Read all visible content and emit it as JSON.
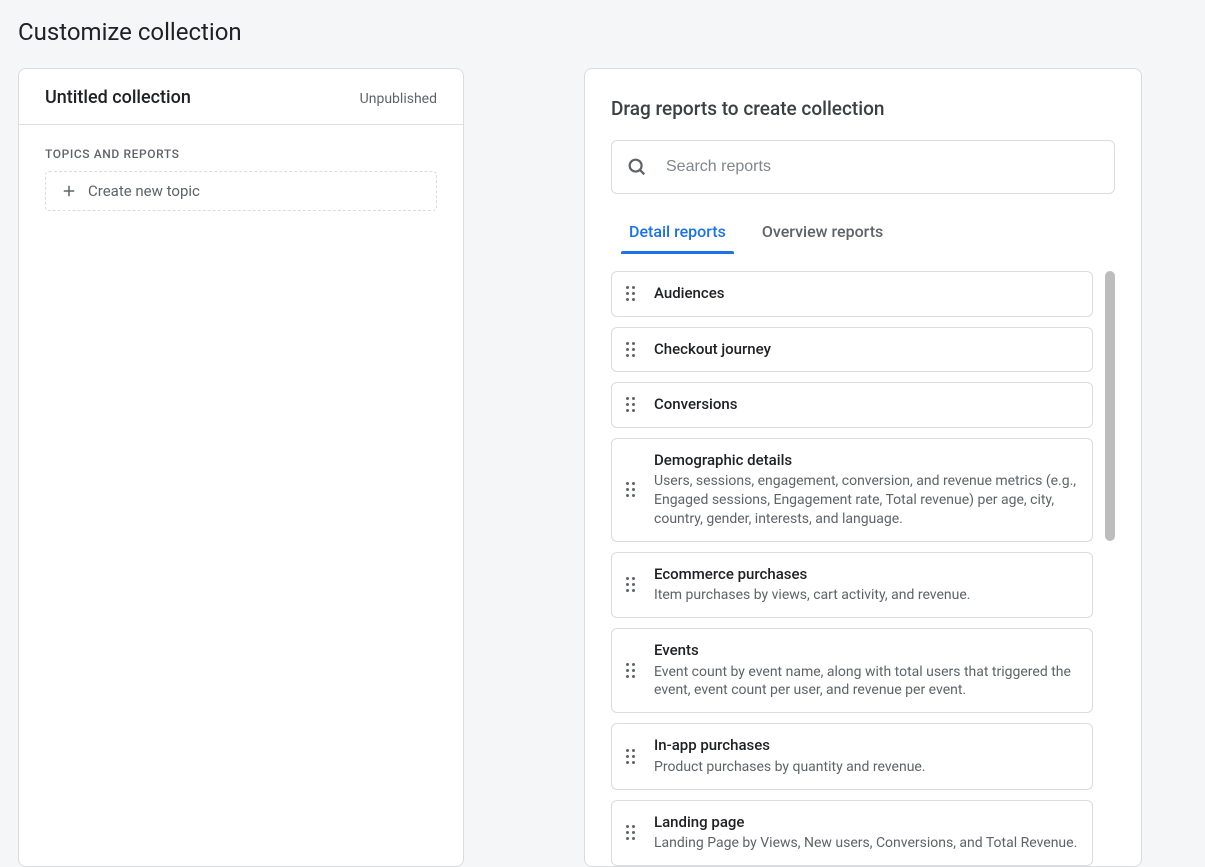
{
  "page": {
    "title": "Customize collection"
  },
  "left": {
    "collection_title": "Untitled collection",
    "status": "Unpublished",
    "section_label": "TOPICS AND REPORTS",
    "create_topic_label": "Create new topic"
  },
  "right": {
    "heading": "Drag reports to create collection",
    "search_placeholder": "Search reports",
    "tabs": {
      "detail": "Detail reports",
      "overview": "Overview reports"
    },
    "reports": [
      {
        "title": "Audiences",
        "desc": ""
      },
      {
        "title": "Checkout journey",
        "desc": ""
      },
      {
        "title": "Conversions",
        "desc": ""
      },
      {
        "title": "Demographic details",
        "desc": "Users, sessions, engagement, conversion, and revenue metrics (e.g., Engaged sessions, Engagement rate, Total revenue) per age, city, country, gender, interests, and language."
      },
      {
        "title": "Ecommerce purchases",
        "desc": "Item purchases by views, cart activity, and revenue."
      },
      {
        "title": "Events",
        "desc": "Event count by event name, along with total users that triggered the event, event count per user, and revenue per event."
      },
      {
        "title": "In-app purchases",
        "desc": "Product purchases by quantity and revenue."
      },
      {
        "title": "Landing page",
        "desc": "Landing Page by Views, New users, Conversions, and Total Revenue."
      }
    ]
  }
}
